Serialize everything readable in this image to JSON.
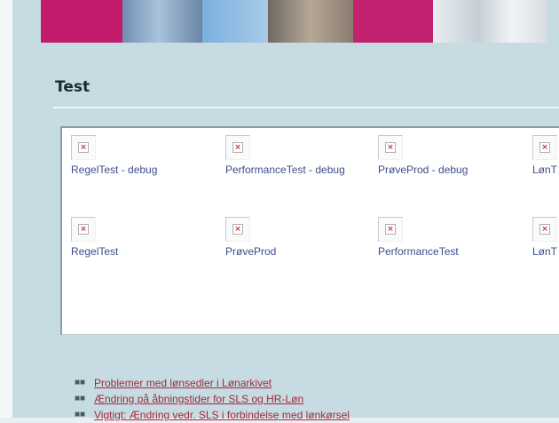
{
  "page": {
    "title": "Test"
  },
  "tiles": [
    {
      "label": "RegelTest - debug",
      "icon": "broken-image-icon"
    },
    {
      "label": "PerformanceTest - debug",
      "icon": "broken-image-icon"
    },
    {
      "label": "PrøveProd - debug",
      "icon": "broken-image-icon"
    },
    {
      "label": "LønT",
      "icon": "broken-image-icon"
    },
    {
      "label": "RegelTest",
      "icon": "broken-image-icon"
    },
    {
      "label": "PrøveProd",
      "icon": "broken-image-icon"
    },
    {
      "label": "PerformanceTest",
      "icon": "broken-image-icon"
    },
    {
      "label": "LønT",
      "icon": "broken-image-icon"
    }
  ],
  "news": [
    {
      "text": "Problemer med lønsedler i Lønarkivet"
    },
    {
      "text": "Ændring på åbningstider for SLS og HR-Løn"
    },
    {
      "text": "Vigtigt: Ændring vedr. SLS i forbindelse med lønkørsel"
    }
  ],
  "colors": {
    "accent_magenta": "#c41c6c",
    "link_blue": "#3e4d8a",
    "link_red": "#a22a3a",
    "panel_bg": "#c6dce2"
  }
}
